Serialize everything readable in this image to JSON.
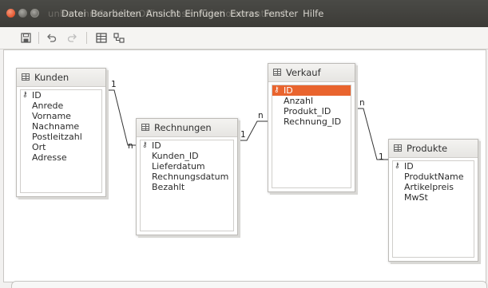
{
  "window": {
    "ghost_title": "unbenannt1 - LibreOffice Base: Relationenentwurf"
  },
  "menubar": {
    "items": [
      "Datei",
      "Bearbeiten",
      "Ansicht",
      "Einfügen",
      "Extras",
      "Fenster",
      "Hilfe"
    ]
  },
  "toolbar": {
    "icons": [
      "save-icon",
      "undo-icon",
      "redo-icon",
      "add-tables-icon",
      "new-relation-icon"
    ]
  },
  "tables": [
    {
      "name": "Kunden",
      "fields": [
        "ID",
        "Anrede",
        "Vorname",
        "Nachname",
        "Postleitzahl",
        "Ort",
        "Adresse"
      ],
      "key_index": 0,
      "selected_index": -1
    },
    {
      "name": "Rechnungen",
      "fields": [
        "ID",
        "Kunden_ID",
        "Lieferdatum",
        "Rechnungsdatum",
        "Bezahlt"
      ],
      "key_index": 0,
      "selected_index": -1
    },
    {
      "name": "Verkauf",
      "fields": [
        "ID",
        "Anzahl",
        "Produkt_ID",
        "Rechnung_ID"
      ],
      "key_index": 0,
      "selected_index": 0
    },
    {
      "name": "Produkte",
      "fields": [
        "ID",
        "ProduktName",
        "Artikelpreis",
        "MwSt"
      ],
      "key_index": 0,
      "selected_index": -1
    }
  ],
  "relations": [
    {
      "from": "Kunden",
      "to": "Rechnungen",
      "from_label": "1",
      "to_label": "n"
    },
    {
      "from": "Rechnungen",
      "to": "Verkauf",
      "from_label": "1",
      "to_label": "n"
    },
    {
      "from": "Verkauf",
      "to": "Produkte",
      "from_label": "n",
      "to_label": "1"
    }
  ],
  "key_symbol": "⚷"
}
